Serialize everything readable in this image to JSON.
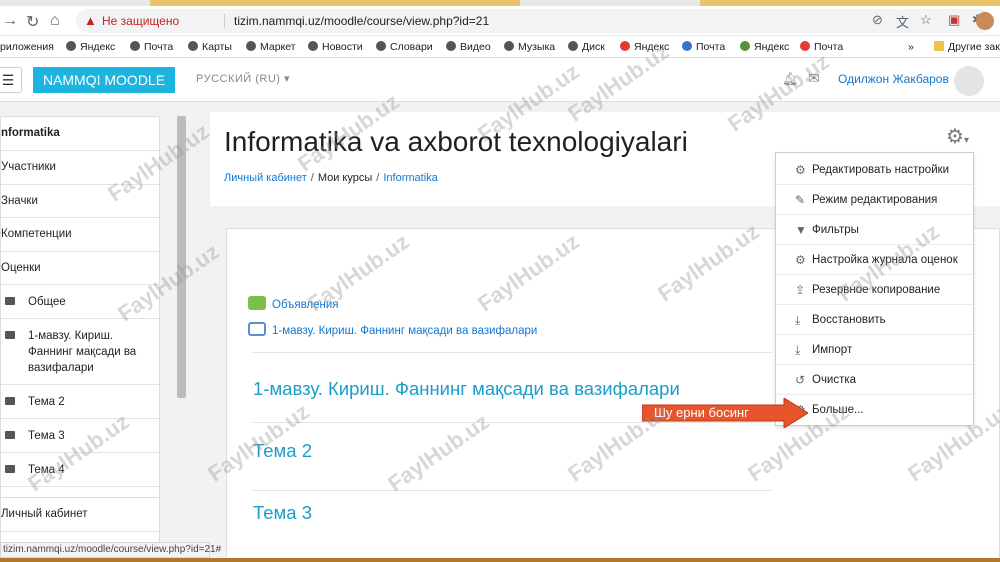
{
  "browser": {
    "insecure_label": "Не защищено",
    "url": "tizim.nammqi.uz/moodle/course/view.php?id=21",
    "bookmarks": [
      "риложения",
      "Яндекс",
      "Почта",
      "Карты",
      "Маркет",
      "Новости",
      "Словари",
      "Видео",
      "Музыка",
      "Диск",
      "Яндекс",
      "Почта",
      "Яндекс",
      "Почта",
      "Другие закл"
    ],
    "more_bookmarks": "»"
  },
  "navbar": {
    "brand": "NAMMQI MOODLE",
    "language": "РУССКИЙ (RU)",
    "user_name": "Одилжон Жакбаров",
    "menu_glyph": "☰"
  },
  "sidebar": {
    "items": [
      "nformatika",
      "Участники",
      "Значки",
      "Компетенции",
      "Оценки"
    ],
    "sections": [
      "Общее",
      "1-мавзу. Кириш. Фаннинг мақсади ва вазифалари",
      "Тема 2",
      "Тема 3",
      "Тема 4"
    ],
    "bottom": "Личный кабинет"
  },
  "course": {
    "title": "Informatika va axborot texnologiyalari",
    "breadcrumb": [
      "Личный кабинет",
      "Мои курсы",
      "Informatika"
    ],
    "breadcrumb_sep": "/",
    "activities": [
      "Объявления",
      "1-мавзу. Кириш. Фаннинг мақсади ва вазифалари"
    ],
    "sections": [
      "1-мавзу. Кириш. Фаннинг мақсади ва вазифалари",
      "Тема 2",
      "Тема 3"
    ]
  },
  "settings_menu": {
    "items": [
      "Редактировать настройки",
      "Режим редактирования",
      "Фильтры",
      "Настройка журнала оценок",
      "Резервное копирование",
      "Восстановить",
      "Импорт",
      "Очистка",
      "Больше..."
    ],
    "icons": [
      "gear-icon",
      "pencil-icon",
      "filter-icon",
      "gear-icon",
      "upload-icon",
      "download-icon",
      "download-icon",
      "reset-icon",
      "gear-icon"
    ]
  },
  "annotation": "Шу ерни босинг",
  "status_url": "tizim.nammqi.uz/moodle/course/view.php?id=21#",
  "watermark": "FaylHub.uz",
  "colors": {
    "brand": "#1db4e0",
    "link": "#1177d1",
    "section": "#1a9dcc",
    "arrow": "#e8542b"
  }
}
